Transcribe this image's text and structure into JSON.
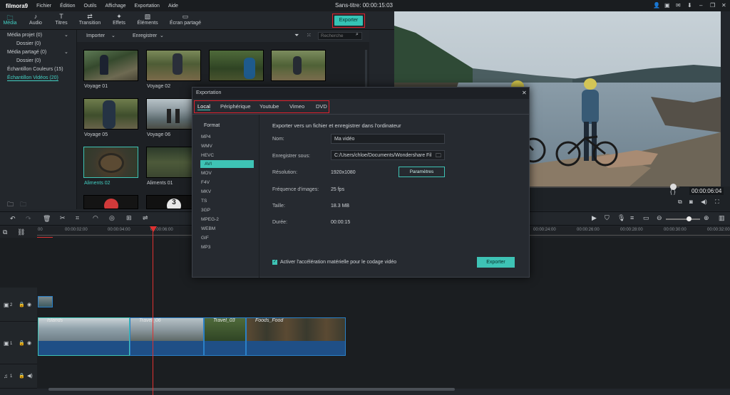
{
  "app": {
    "name": "filmora9",
    "title": "Sans-titre:",
    "timecode": "00:00:15:03"
  },
  "menu": [
    "Fichier",
    "Édition",
    "Outils",
    "Affichage",
    "Exportation",
    "Aide"
  ],
  "toolbar": {
    "tabs": [
      {
        "label": "Média",
        "icon": "folder-icon"
      },
      {
        "label": "Audio",
        "icon": "music-note-icon"
      },
      {
        "label": "Titres",
        "icon": "text-icon"
      },
      {
        "label": "Transition",
        "icon": "transition-icon"
      },
      {
        "label": "Effets",
        "icon": "effects-icon"
      },
      {
        "label": "Éléments",
        "icon": "elements-icon"
      },
      {
        "label": "Écran partagé",
        "icon": "split-screen-icon"
      }
    ],
    "export_label": "Exporter"
  },
  "library": {
    "items": [
      "Média projet (0)",
      "Dossier (0)",
      "Média partagé (0)",
      "Dossier (0)",
      "Échantillon Couleurs (15)",
      "Échantillon Vidéos (20)"
    ]
  },
  "media_bar": {
    "import_label": "Importer",
    "record_label": "Enregistrer",
    "search_placeholder": "Recherche"
  },
  "media": {
    "items": [
      {
        "label": "Voyage 01"
      },
      {
        "label": "Voyage 02"
      },
      {
        "label": "Voyage 03"
      },
      {
        "label": "Voyage 04"
      },
      {
        "label": "Voyage 05"
      },
      {
        "label": "Voyage 06"
      },
      {
        "label": "Aliments 02"
      },
      {
        "label": "Aliments 01"
      }
    ]
  },
  "preview": {
    "time": "00:00:06:04",
    "bracket": "{ }"
  },
  "ruler": {
    "ticks": [
      "00:00:02:00",
      "00:00:04:00",
      "00:00:06:00",
      "00:00:24:00",
      "00:00:26:00",
      "00:00:28:00",
      "00:00:30:00",
      "00:00:32:00"
    ]
  },
  "tracks": [
    {
      "label": "2"
    },
    {
      "label": "1"
    },
    {
      "label": "1"
    }
  ],
  "clips": [
    "Islands",
    "Travel_06",
    "Travel_03",
    "Foods_Food"
  ],
  "dialog": {
    "title": "Exportation",
    "tabs": [
      "Local",
      "Périphérique",
      "Youtube",
      "Vimeo",
      "DVD"
    ],
    "format_heading": "Format",
    "formats": [
      "MP4",
      "WMV",
      "HEVC",
      "AVI",
      "MOV",
      "F4V",
      "MKV",
      "TS",
      "3GP",
      "MPEG-2",
      "WEBM",
      "GIF",
      "MP3"
    ],
    "heading": "Exporter vers un fichier et enregistrer dans l'ordinateur",
    "name_label": "Nom:",
    "name_value": "Ma vidéo",
    "save_label": "Enregistrer sous:",
    "save_value": "C:/Users/chloe/Documents/Wondershare Fil",
    "resolution_label": "Résolution:",
    "resolution_value": "1920x1080",
    "settings_label": "Paramètres",
    "framerate_label": "Fréquence d'images:",
    "framerate_value": "25 fps",
    "size_label": "Taille:",
    "size_value": "18.3 MB",
    "duration_label": "Durée:",
    "duration_value": "00:00:15",
    "gpu_label": "Activer l'accélération matérielle pour le codage vidéo",
    "export_label": "Exporter"
  },
  "colors": {
    "accent": "#3ec3b5",
    "highlight": "#e0212d",
    "clip": "#1f4f86"
  }
}
